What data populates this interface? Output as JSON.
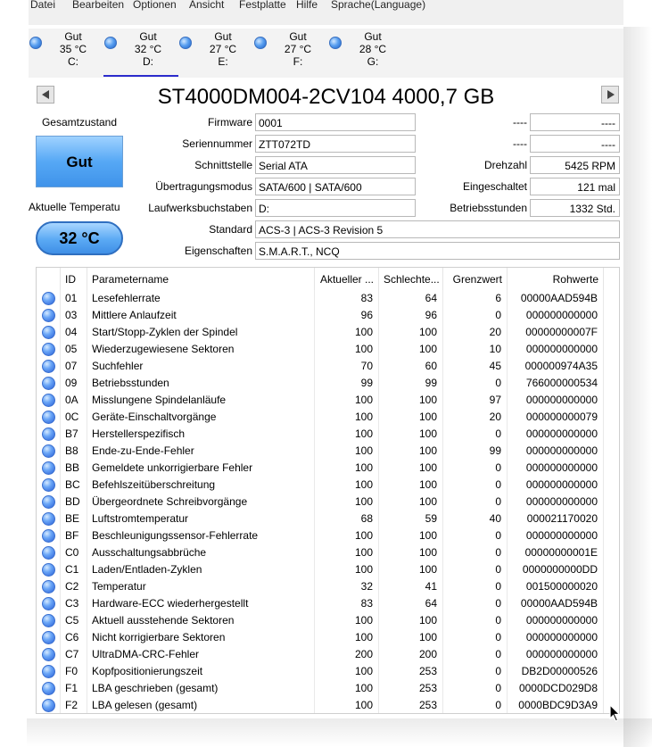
{
  "menu": [
    "Datei",
    "Bearbeiten",
    "Optionen",
    "Ansicht",
    "Festplatte",
    "Hilfe",
    "Sprache(Language)"
  ],
  "disks": [
    {
      "status": "Gut",
      "temp": "35 °C",
      "letter": "C:",
      "active": false
    },
    {
      "status": "Gut",
      "temp": "32 °C",
      "letter": "D:",
      "active": true
    },
    {
      "status": "Gut",
      "temp": "27 °C",
      "letter": "E:",
      "active": false
    },
    {
      "status": "Gut",
      "temp": "27 °C",
      "letter": "F:",
      "active": false
    },
    {
      "status": "Gut",
      "temp": "28 °C",
      "letter": "G:",
      "active": false
    }
  ],
  "drive_title": "ST4000DM004-2CV104 4000,7 GB",
  "health": {
    "label": "Gesamtzustand",
    "value": "Gut"
  },
  "temperature": {
    "label": "Aktuelle Temperatu",
    "value": "32 °C"
  },
  "info": {
    "firmware": {
      "label": "Firmware",
      "value": "0001"
    },
    "serial": {
      "label": "Seriennummer",
      "value": "ZTT072TD"
    },
    "interface": {
      "label": "Schnittstelle",
      "value": "Serial ATA"
    },
    "transfer": {
      "label": "Übertragungsmodus",
      "value": "SATA/600 | SATA/600"
    },
    "drive_letters": {
      "label": "Laufwerksbuchstaben",
      "value": "D:"
    },
    "standard": {
      "label": "Standard",
      "value": "ACS-3 | ACS-3 Revision 5"
    },
    "features": {
      "label": "Eigenschaften",
      "value": "S.M.A.R.T., NCQ"
    },
    "right1": {
      "label": "----",
      "value": "----"
    },
    "right2": {
      "label": "----",
      "value": "----"
    },
    "rpm": {
      "label": "Drehzahl",
      "value": "5425 RPM"
    },
    "power_count": {
      "label": "Eingeschaltet",
      "value": "121 mal"
    },
    "power_hours": {
      "label": "Betriebsstunden",
      "value": "1332 Std."
    }
  },
  "table": {
    "headers": [
      "ID",
      "Parametername",
      "Aktueller ...",
      "Schlechte...",
      "Grenzwert",
      "Rohwerte"
    ],
    "rows": [
      [
        "01",
        "Lesefehlerrate",
        "83",
        "64",
        "6",
        "00000AAD594B"
      ],
      [
        "03",
        "Mittlere Anlaufzeit",
        "96",
        "96",
        "0",
        "000000000000"
      ],
      [
        "04",
        "Start/Stopp-Zyklen der Spindel",
        "100",
        "100",
        "20",
        "00000000007F"
      ],
      [
        "05",
        "Wiederzugewiesene Sektoren",
        "100",
        "100",
        "10",
        "000000000000"
      ],
      [
        "07",
        "Suchfehler",
        "70",
        "60",
        "45",
        "000000974A35"
      ],
      [
        "09",
        "Betriebsstunden",
        "99",
        "99",
        "0",
        "766000000534"
      ],
      [
        "0A",
        "Misslungene Spindelanläufe",
        "100",
        "100",
        "97",
        "000000000000"
      ],
      [
        "0C",
        "Geräte-Einschaltvorgänge",
        "100",
        "100",
        "20",
        "000000000079"
      ],
      [
        "B7",
        "Herstellerspezifisch",
        "100",
        "100",
        "0",
        "000000000000"
      ],
      [
        "B8",
        "Ende-zu-Ende-Fehler",
        "100",
        "100",
        "99",
        "000000000000"
      ],
      [
        "BB",
        "Gemeldete unkorrigierbare Fehler",
        "100",
        "100",
        "0",
        "000000000000"
      ],
      [
        "BC",
        "Befehlszeitüberschreitung",
        "100",
        "100",
        "0",
        "000000000000"
      ],
      [
        "BD",
        "Übergeordnete Schreibvorgänge",
        "100",
        "100",
        "0",
        "000000000000"
      ],
      [
        "BE",
        "Luftstromtemperatur",
        "68",
        "59",
        "40",
        "000021170020"
      ],
      [
        "BF",
        "Beschleunigungssensor-Fehlerrate",
        "100",
        "100",
        "0",
        "000000000000"
      ],
      [
        "C0",
        "Ausschaltungsabbrüche",
        "100",
        "100",
        "0",
        "00000000001E"
      ],
      [
        "C1",
        "Laden/Entladen-Zyklen",
        "100",
        "100",
        "0",
        "0000000000DD"
      ],
      [
        "C2",
        "Temperatur",
        "32",
        "41",
        "0",
        "001500000020"
      ],
      [
        "C3",
        "Hardware-ECC wiederhergestellt",
        "83",
        "64",
        "0",
        "00000AAD594B"
      ],
      [
        "C5",
        "Aktuell ausstehende Sektoren",
        "100",
        "100",
        "0",
        "000000000000"
      ],
      [
        "C6",
        "Nicht korrigierbare Sektoren",
        "100",
        "100",
        "0",
        "000000000000"
      ],
      [
        "C7",
        "UltraDMA-CRC-Fehler",
        "200",
        "200",
        "0",
        "000000000000"
      ],
      [
        "F0",
        "Kopfpositionierungszeit",
        "100",
        "253",
        "0",
        "DB2D00000526"
      ],
      [
        "F1",
        "LBA geschrieben (gesamt)",
        "100",
        "253",
        "0",
        "0000DCD029D8"
      ],
      [
        "F2",
        "LBA gelesen (gesamt)",
        "100",
        "253",
        "0",
        "0000BDC9D3A9"
      ]
    ]
  }
}
